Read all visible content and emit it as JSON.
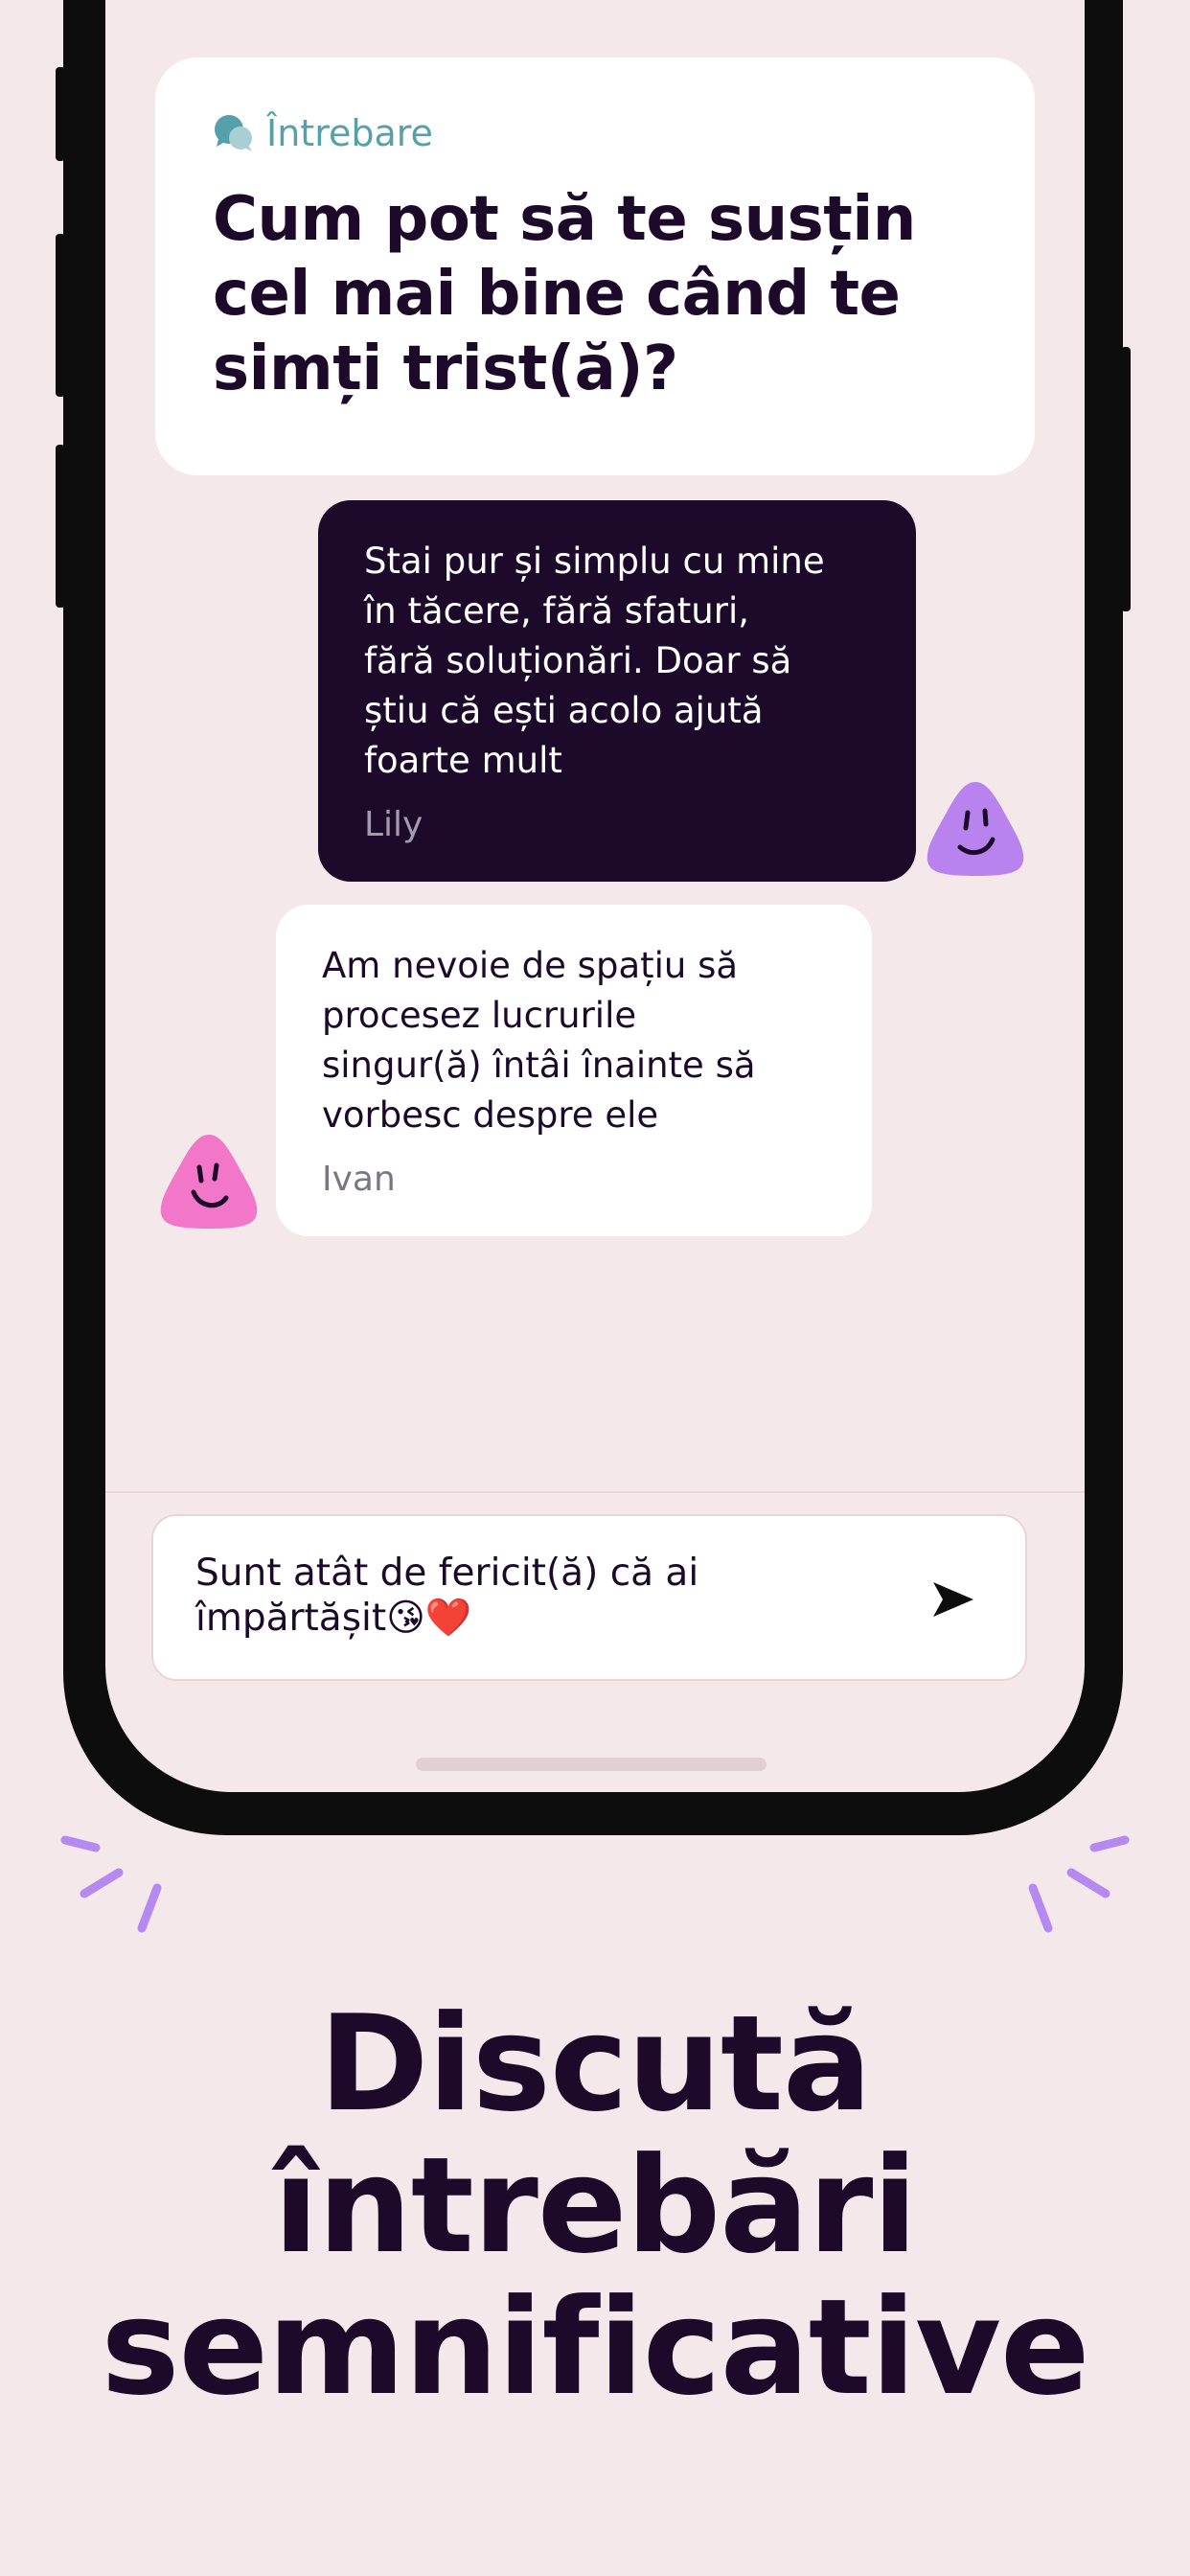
{
  "question": {
    "tag_label": "Întrebare",
    "text_lines": [
      "Cum pot să te susțin",
      "cel mai bine când te",
      "simți trist(ă)?"
    ]
  },
  "messages": [
    {
      "text_lines": [
        "Stai pur și simplu cu mine",
        "în tăcere, fără sfaturi,",
        "fără soluționări. Doar să",
        "știu că ești acolo ajută",
        "foarte mult"
      ],
      "author": "Lily",
      "avatar_color": "#b883ef"
    },
    {
      "text_lines": [
        "Am nevoie de spațiu să",
        "procesez lucrurile",
        "singur(ă) întâi înainte să",
        "vorbesc despre ele"
      ],
      "author": "Ivan",
      "avatar_color": "#f277c8"
    }
  ],
  "composer": {
    "text_lines": [
      "Sunt atât de fericit(ă) că ai",
      "împărtășit😘❤️"
    ]
  },
  "headline": {
    "lines": [
      "Discută",
      "întrebări",
      "semnificative"
    ]
  },
  "colors": {
    "background": "#f5e8ea",
    "ink": "#1d0a2b",
    "accent_teal": "#56a0ac",
    "sparkle": "#b58af0"
  }
}
